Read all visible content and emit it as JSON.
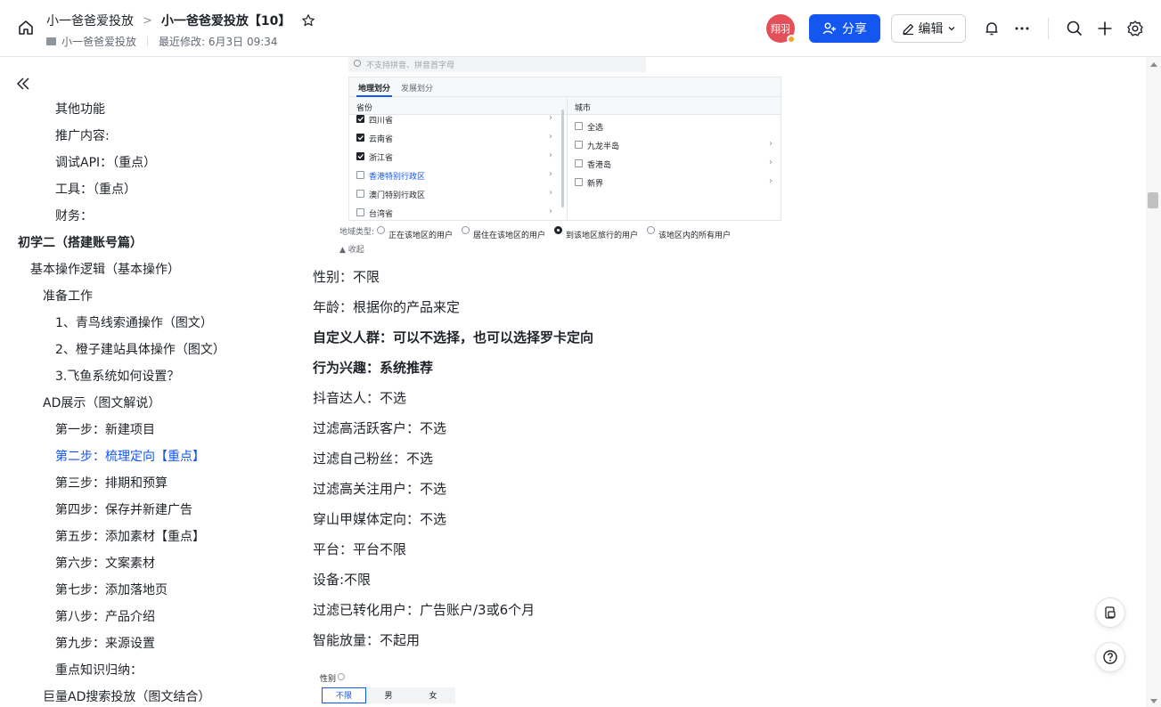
{
  "header": {
    "breadcrumb_parent": "小一爸爸爱投放",
    "breadcrumb_separator": ">",
    "title": "小一爸爸爱投放【10】",
    "sub_folder": "小一爸爸爱投放",
    "last_modified": "最近修改: 6月3日 09:34",
    "avatar_text": "翔羽",
    "share_label": "分享",
    "edit_label": "编辑"
  },
  "colors": {
    "accent": "#1456f0",
    "avatar": "#e3505a",
    "status_dot": "#f5a623"
  },
  "toc": [
    {
      "label": "其他功能",
      "level": 4
    },
    {
      "label": "推广内容:",
      "level": 4
    },
    {
      "label": "调试API：（重点）",
      "level": 4
    },
    {
      "label": "工具：（重点）",
      "level": 4
    },
    {
      "label": "财务：",
      "level": 4
    },
    {
      "label": "初学二（搭建账号篇）",
      "level": 1
    },
    {
      "label": "基本操作逻辑（基本操作）",
      "level": 2
    },
    {
      "label": "准备工作",
      "level": 3
    },
    {
      "label": "1、青鸟线索通操作（图文）",
      "level": 4
    },
    {
      "label": "2、橙子建站具体操作（图文）",
      "level": 4
    },
    {
      "label": "3.飞鱼系统如何设置？",
      "level": 4
    },
    {
      "label": "AD展示（图文解说）",
      "level": 3
    },
    {
      "label": "第一步：新建项目",
      "level": 4
    },
    {
      "label": "第二步：梳理定向【重点】",
      "level": 4,
      "active": true
    },
    {
      "label": "第三步：排期和预算",
      "level": 4
    },
    {
      "label": "第四步：保存并新建广告",
      "level": 4
    },
    {
      "label": "第五步：添加素材【重点】",
      "level": 4
    },
    {
      "label": "第六步：文案素材",
      "level": 4
    },
    {
      "label": "第七步：添加落地页",
      "level": 4
    },
    {
      "label": "第八步：产品介绍",
      "level": 4
    },
    {
      "label": "第九步：来源设置",
      "level": 4
    },
    {
      "label": "重点知识归纳：",
      "level": 4
    },
    {
      "label": "巨量AD搜索投放（图文结合）",
      "level": 3
    }
  ],
  "region_shot": {
    "search_placeholder": "不支持拼音、拼音首字母",
    "tab_active": "地理划分",
    "tab_other": "发展划分",
    "col_province": "省份",
    "col_city": "城市",
    "provinces": [
      {
        "label": "四川省",
        "checked": true
      },
      {
        "label": "云南省",
        "checked": true
      },
      {
        "label": "浙江省",
        "checked": true
      },
      {
        "label": "香港特别行政区",
        "checked": false,
        "highlight": true
      },
      {
        "label": "澳门特别行政区",
        "checked": false
      },
      {
        "label": "台湾省",
        "checked": false
      }
    ],
    "cities": [
      {
        "label": "全选",
        "arrow": false
      },
      {
        "label": "九龙半岛",
        "arrow": true
      },
      {
        "label": "香港岛",
        "arrow": true
      },
      {
        "label": "新界",
        "arrow": true
      }
    ],
    "type_label": "地域类型:",
    "type_options": [
      {
        "label": "正在该地区的用户",
        "selected": false
      },
      {
        "label": "居住在该地区的用户",
        "selected": false
      },
      {
        "label": "到该地区旅行的用户",
        "selected": true
      },
      {
        "label": "该地区内的所有用户",
        "selected": false
      }
    ],
    "collapse_label": "收起"
  },
  "paragraphs": [
    {
      "text": "性别：不限",
      "bold": false
    },
    {
      "text": "年龄：根据你的产品来定",
      "bold": false
    },
    {
      "text": "自定义人群：可以不选择，也可以选择罗卡定向",
      "bold": true
    },
    {
      "text": "行为兴趣：系统推荐",
      "bold": true
    },
    {
      "text": "抖音达人：不选",
      "bold": false
    },
    {
      "text": "过滤高活跃客户：不选",
      "bold": false
    },
    {
      "text": "过滤自己粉丝：不选",
      "bold": false
    },
    {
      "text": "过滤高关注用户：不选",
      "bold": false
    },
    {
      "text": "穿山甲媒体定向：不选",
      "bold": false
    },
    {
      "text": "平台：平台不限",
      "bold": false
    },
    {
      "text": "设备:不限",
      "bold": false
    },
    {
      "text": "过滤已转化用户：广告账户/3或6个月",
      "bold": false
    },
    {
      "text": "智能放量：不起用",
      "bold": false
    }
  ],
  "gender_shot": {
    "label": "性别",
    "options": [
      "不限",
      "男",
      "女"
    ]
  }
}
